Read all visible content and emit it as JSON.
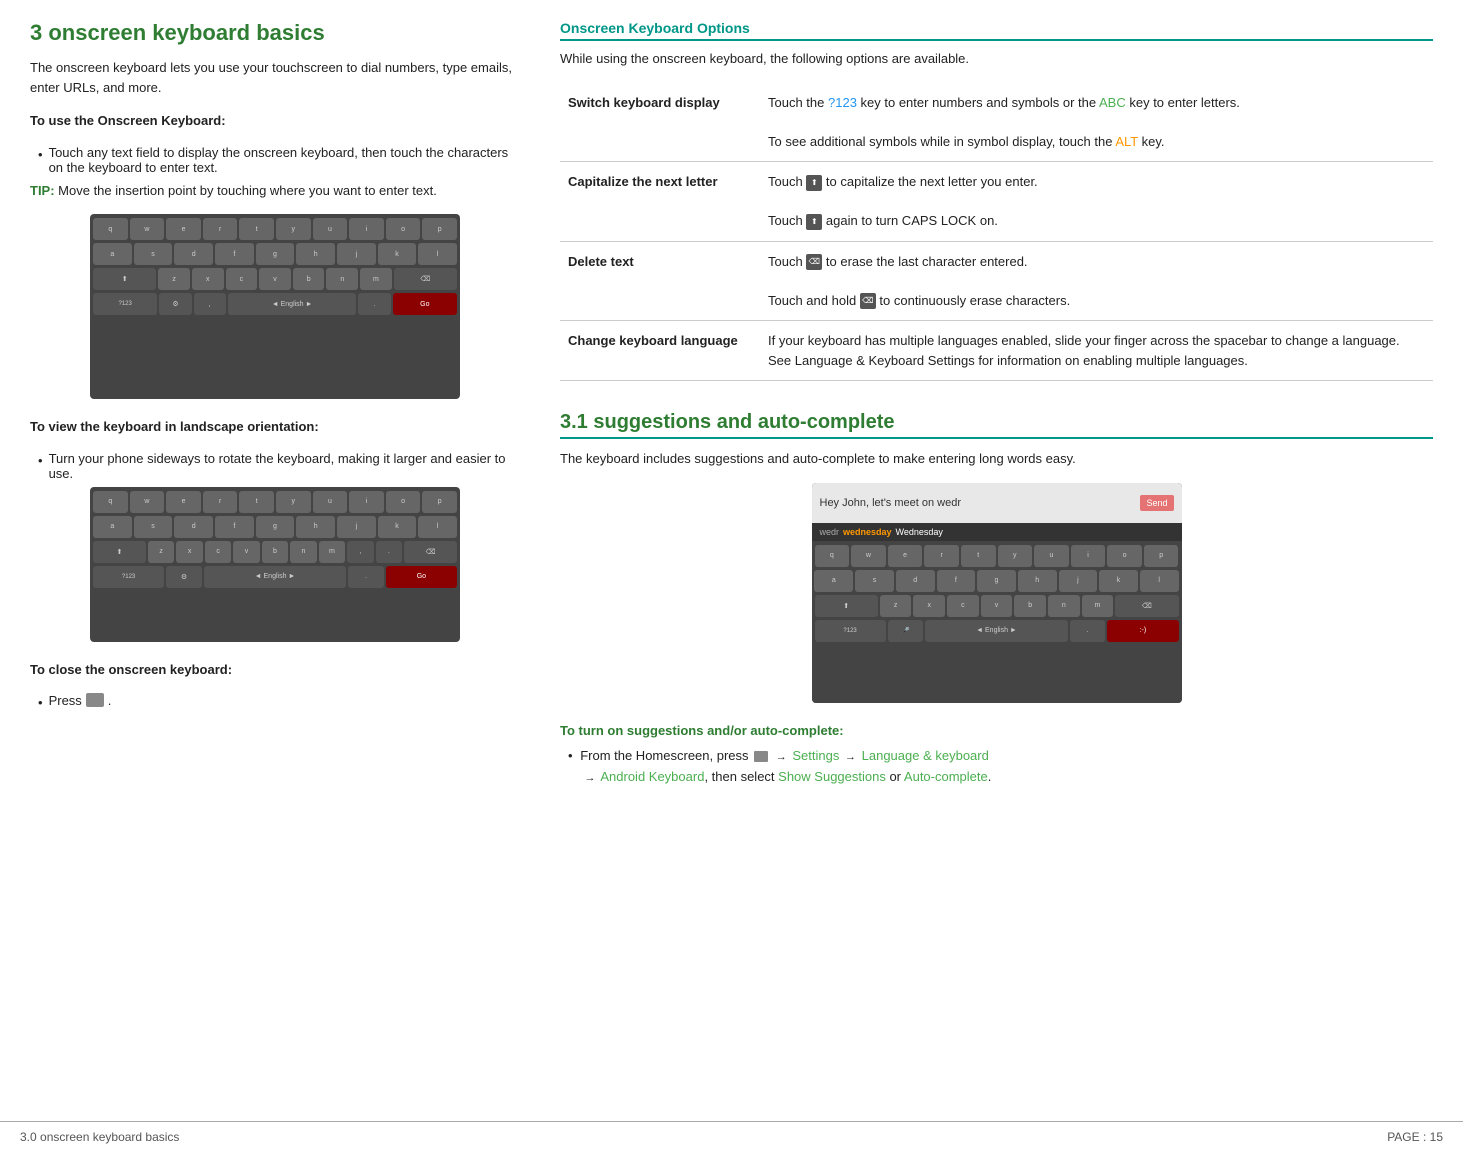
{
  "page": {
    "footer_left": "3.0 onscreen keyboard basics",
    "footer_right": "PAGE : 15"
  },
  "left_column": {
    "heading": "3 onscreen keyboard basics",
    "intro": "The onscreen keyboard lets you use your touchscreen to dial numbers, type emails, enter URLs, and more.",
    "section1_heading": "To use the Onscreen Keyboard:",
    "section1_bullet": "Touch any text field to display the onscreen keyboard, then touch the characters on the keyboard to enter text.",
    "tip_label": "TIP:",
    "tip_text": " Move the insertion point by touching where you want to enter text.",
    "section2_heading": "To view the keyboard in landscape orientation:",
    "section2_bullet": "Turn your phone sideways to rotate the keyboard, making it larger and easier to use.",
    "section3_heading": "To close the onscreen keyboard:",
    "section3_bullet": "Press",
    "section3_bullet_end": " ."
  },
  "right_column": {
    "options_heading": "Onscreen Keyboard Options",
    "options_intro": "While using the onscreen keyboard, the following options are available.",
    "table": [
      {
        "term": "Switch keyboard display",
        "desc1": "Touch the ?123 key to enter numbers and symbols or the ABC key to enter letters.",
        "desc2": "To see additional symbols while in symbol display, touch the ALT key.",
        "colored": {
          "q123": "?123",
          "abc": "ABC",
          "alt": "ALT"
        }
      },
      {
        "term": "Capitalize the next letter",
        "desc1": "Touch [icon] to capitalize the next letter you enter.",
        "desc2": "Touch [icon] again to turn CAPS LOCK on."
      },
      {
        "term": "Delete text",
        "desc1": "Touch [icon] to erase the last character entered.",
        "desc2": "Touch and hold [icon] to continuously erase characters."
      },
      {
        "term": "Change keyboard language",
        "desc1": "If your keyboard has multiple languages enabled, slide your finger across the spacebar to change a language. See Language & Keyboard Settings for information on enabling multiple languages."
      }
    ],
    "section31_heading": "3.1 suggestions and auto-complete",
    "section31_intro": "The keyboard includes suggestions and auto-complete to make entering long words easy.",
    "section31_bullets_heading": "To turn on suggestions and/or auto-complete:",
    "section31_bullet": "From the Homescreen, press",
    "section31_bullet_mid1": "Settings",
    "section31_bullet_mid2": "Language & keyboard",
    "section31_bullet_mid3": "Android Keyboard",
    "section31_bullet_end1": ", then select",
    "section31_bullet_end2": "Show Suggestions",
    "section31_bullet_end3": "or",
    "section31_bullet_end4": "Auto-complete",
    "section31_bullet_period": "."
  }
}
